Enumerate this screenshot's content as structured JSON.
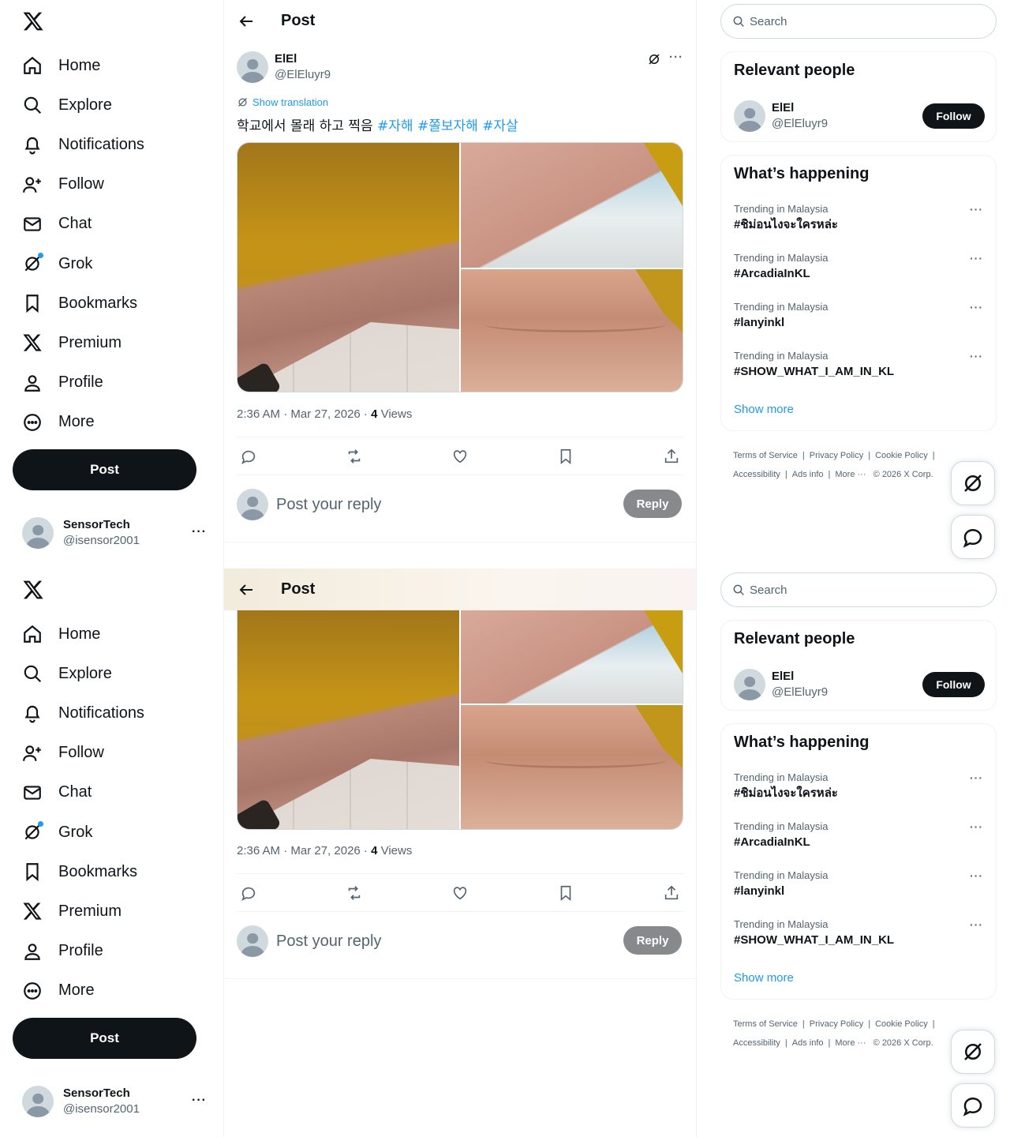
{
  "nav": {
    "items": [
      {
        "label": "Home"
      },
      {
        "label": "Explore"
      },
      {
        "label": "Notifications"
      },
      {
        "label": "Follow"
      },
      {
        "label": "Chat"
      },
      {
        "label": "Grok"
      },
      {
        "label": "Bookmarks"
      },
      {
        "label": "Premium"
      },
      {
        "label": "Profile"
      },
      {
        "label": "More"
      }
    ],
    "post_label": "Post"
  },
  "account": {
    "name": "SensorTech",
    "handle": "@isensor2001",
    "more": "···"
  },
  "header": {
    "title": "Post"
  },
  "tweet": {
    "author_name": "ElEl",
    "author_handle": "@ElEluyr9",
    "more": "···",
    "translate_label": "Show translation",
    "text": "학교에서 몰래 하고 찍음",
    "hashtags": [
      "#자해",
      "#쫄보자해",
      "#자살"
    ],
    "time": "2:36 AM · Mar 27, 2026 · ",
    "views_count": "4",
    "views_label": " Views"
  },
  "reply": {
    "placeholder": "Post your reply",
    "button": "Reply"
  },
  "right": {
    "search_placeholder": "Search",
    "relevant_title": "Relevant people",
    "person": {
      "name": "ElEl",
      "handle": "@ElEluyr9",
      "follow": "Follow"
    },
    "happening_title": "What’s happening",
    "trends": [
      {
        "context": "Trending in Malaysia",
        "name": "#ชิม่อนไงจะใครหล่ะ"
      },
      {
        "context": "Trending in Malaysia",
        "name": "#ArcadiaInKL"
      },
      {
        "context": "Trending in Malaysia",
        "name": "#lanyinkl"
      },
      {
        "context": "Trending in Malaysia",
        "name": "#SHOW_WHAT_I_AM_IN_KL"
      }
    ],
    "trend_more": "···",
    "show_more": "Show more",
    "footer": {
      "terms": "Terms of Service",
      "privacy": "Privacy Policy",
      "cookie": "Cookie Policy",
      "accessibility": "Accessibility",
      "ads": "Ads info",
      "more": "More ···",
      "copyright": "© 2026 X Corp."
    },
    "separator": "|"
  },
  "colors": {
    "accent": "#1d9bf0",
    "text": "#0f1419",
    "muted": "#536471",
    "button_dark": "#0f1419",
    "reply_disabled": "#878a8c"
  }
}
